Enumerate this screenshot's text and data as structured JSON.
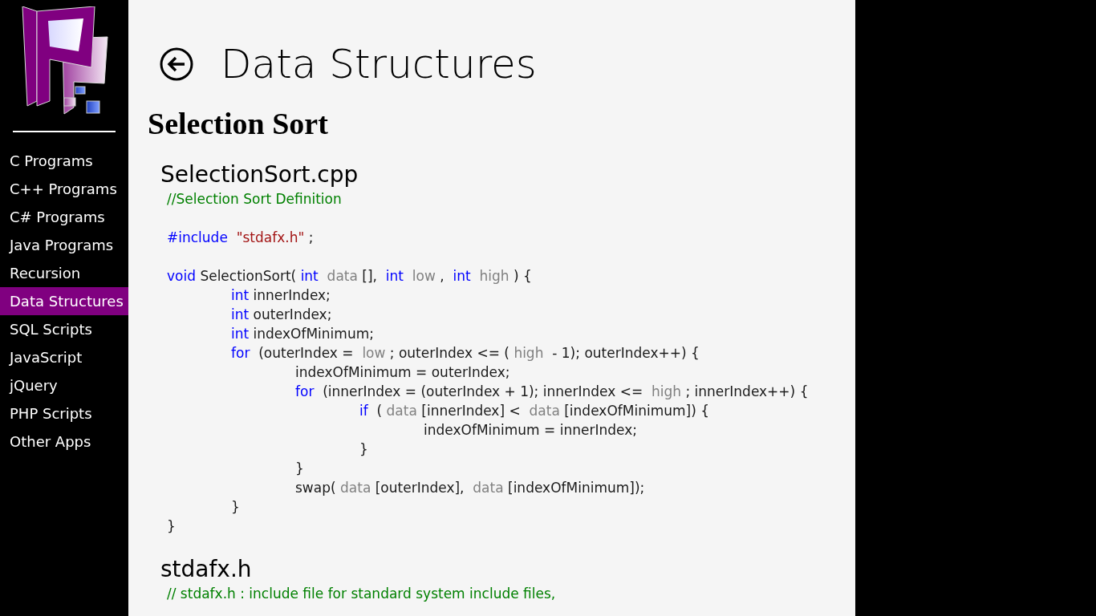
{
  "sidebar": {
    "items": [
      {
        "label": "C Programs",
        "selected": false
      },
      {
        "label": "C++ Programs",
        "selected": false
      },
      {
        "label": "C# Programs",
        "selected": false
      },
      {
        "label": "Java Programs",
        "selected": false
      },
      {
        "label": "Recursion",
        "selected": false
      },
      {
        "label": "Data Structures",
        "selected": true
      },
      {
        "label": "SQL Scripts",
        "selected": false
      },
      {
        "label": "JavaScript",
        "selected": false
      },
      {
        "label": "jQuery",
        "selected": false
      },
      {
        "label": "PHP Scripts",
        "selected": false
      },
      {
        "label": "Other Apps",
        "selected": false
      }
    ]
  },
  "page": {
    "title": "Data Structures",
    "heading": "Selection Sort",
    "files": [
      {
        "name": "SelectionSort.cpp",
        "sections": [
          [
            {
              "tokens": [
                {
                  "kind": "comment",
                  "text": "//Selection Sort Definition"
                }
              ]
            }
          ],
          [
            {
              "tokens": [
                {
                  "kind": "keyword",
                  "text": "#include"
                },
                {
                  "kind": "string",
                  "text": " \"stdafx.h\""
                },
                {
                  "kind": "plain",
                  "text": ";"
                }
              ]
            }
          ],
          [
            {
              "tokens": [
                {
                  "kind": "keyword",
                  "text": "void"
                },
                {
                  "kind": "plain",
                  "text": "SelectionSort("
                },
                {
                  "kind": "keyword",
                  "text": "int"
                },
                {
                  "kind": "param",
                  "text": " data"
                },
                {
                  "kind": "plain",
                  "text": "[], "
                },
                {
                  "kind": "keyword",
                  "text": "int"
                },
                {
                  "kind": "param",
                  "text": " low"
                },
                {
                  "kind": "plain",
                  "text": ", "
                },
                {
                  "kind": "keyword",
                  "text": "int"
                },
                {
                  "kind": "param",
                  "text": " high"
                },
                {
                  "kind": "plain",
                  "text": ") {"
                }
              ],
              "children": [
                {
                  "tokens": [
                    {
                      "kind": "keyword",
                      "text": "int"
                    },
                    {
                      "kind": "plain",
                      "text": "innerIndex;"
                    }
                  ]
                },
                {
                  "tokens": [
                    {
                      "kind": "keyword",
                      "text": "int"
                    },
                    {
                      "kind": "plain",
                      "text": "outerIndex;"
                    }
                  ]
                },
                {
                  "tokens": [
                    {
                      "kind": "keyword",
                      "text": "int"
                    },
                    {
                      "kind": "plain",
                      "text": "indexOfMinimum;"
                    }
                  ]
                },
                {
                  "tokens": [
                    {
                      "kind": "keyword",
                      "text": "for"
                    },
                    {
                      "kind": "plain",
                      "text": " (outerIndex = "
                    },
                    {
                      "kind": "param",
                      "text": "low"
                    },
                    {
                      "kind": "plain",
                      "text": "; outerIndex <= ("
                    },
                    {
                      "kind": "param",
                      "text": "high"
                    },
                    {
                      "kind": "plain",
                      "text": " - 1); outerIndex++) {"
                    }
                  ],
                  "children": [
                    {
                      "tokens": [
                        {
                          "kind": "plain",
                          "text": "indexOfMinimum = outerIndex;"
                        }
                      ]
                    },
                    {
                      "tokens": [
                        {
                          "kind": "keyword",
                          "text": "for"
                        },
                        {
                          "kind": "plain",
                          "text": " (innerIndex = (outerIndex + 1); innerIndex <= "
                        },
                        {
                          "kind": "param",
                          "text": "high"
                        },
                        {
                          "kind": "plain",
                          "text": "; innerIndex++) {"
                        }
                      ],
                      "children": [
                        {
                          "tokens": [
                            {
                              "kind": "keyword",
                              "text": "if"
                            },
                            {
                              "kind": "plain",
                              "text": " ("
                            },
                            {
                              "kind": "param",
                              "text": "data"
                            },
                            {
                              "kind": "plain",
                              "text": "[innerIndex] < "
                            },
                            {
                              "kind": "param",
                              "text": "data"
                            },
                            {
                              "kind": "plain",
                              "text": "[indexOfMinimum]) {"
                            }
                          ],
                          "children": [
                            {
                              "tokens": [
                                {
                                  "kind": "plain",
                                  "text": "indexOfMinimum = innerIndex;"
                                }
                              ]
                            }
                          ]
                        },
                        {
                          "tokens": [
                            {
                              "kind": "plain",
                              "text": "}"
                            }
                          ]
                        }
                      ]
                    },
                    {
                      "tokens": [
                        {
                          "kind": "plain",
                          "text": "}"
                        }
                      ]
                    },
                    {
                      "tokens": [
                        {
                          "kind": "plain",
                          "text": "swap("
                        },
                        {
                          "kind": "param",
                          "text": "data"
                        },
                        {
                          "kind": "plain",
                          "text": "[outerIndex], "
                        },
                        {
                          "kind": "param",
                          "text": "data"
                        },
                        {
                          "kind": "plain",
                          "text": "[indexOfMinimum]);"
                        }
                      ]
                    }
                  ]
                },
                {
                  "tokens": [
                    {
                      "kind": "plain",
                      "text": "}"
                    }
                  ]
                }
              ]
            },
            {
              "tokens": [
                {
                  "kind": "plain",
                  "text": "}"
                }
              ]
            }
          ]
        ]
      },
      {
        "name": "stdafx.h",
        "sections": [
          [
            {
              "tokens": [
                {
                  "kind": "comment",
                  "text": "// stdafx.h : include file for standard system include files,"
                }
              ]
            }
          ]
        ]
      }
    ]
  }
}
